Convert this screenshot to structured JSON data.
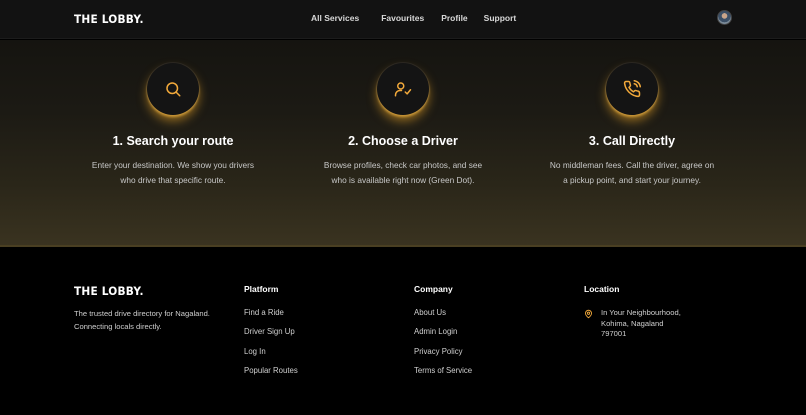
{
  "header": {
    "logo": "THE LOBBY.",
    "nav": [
      "All Services",
      "Favourites",
      "Profile",
      "Support"
    ]
  },
  "steps": [
    {
      "icon": "search-icon",
      "title": "1. Search your route",
      "desc_line1": "Enter your destination. We show you drivers",
      "desc_line2": "who drive that specific route."
    },
    {
      "icon": "user-check-icon",
      "title": "2. Choose a Driver",
      "desc_line1": "Browse profiles, check car photos, and see",
      "desc_line2": "who is available right now (Green Dot)."
    },
    {
      "icon": "phone-call-icon",
      "title": "3. Call Directly",
      "desc_line1": "No middleman fees. Call the driver, agree on",
      "desc_line2": "a pickup point, and start your journey."
    }
  ],
  "footer": {
    "logo": "THE LOBBY.",
    "desc_line1": "The trusted drive directory for Nagaland.",
    "desc_line2": "Connecting locals directly.",
    "platform": {
      "title": "Platform",
      "links": [
        "Find a Ride",
        "Driver Sign Up",
        "Log In",
        "Popular Routes"
      ]
    },
    "company": {
      "title": "Company",
      "links": [
        "About Us",
        "Admin Login",
        "Privacy Policy",
        "Terms of Service"
      ]
    },
    "location": {
      "title": "Location",
      "line1": "In Your Neighbourhood,",
      "line2": "Kohima, Nagaland",
      "line3": "797001"
    }
  },
  "colors": {
    "accent": "#f2a93b",
    "background": "#000000",
    "header": "#121212"
  }
}
